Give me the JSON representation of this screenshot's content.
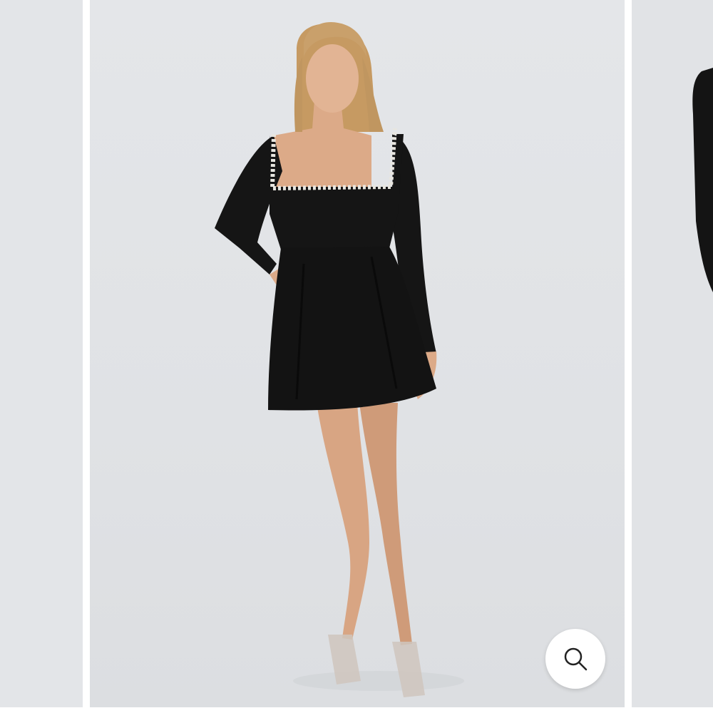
{
  "gallery": {
    "prev_image_label": "",
    "current_image_label": "",
    "next_image_label": ""
  },
  "zoom": {
    "icon": "search-icon"
  },
  "colors": {
    "background": "#e1e3e6",
    "dress": "#151515",
    "pearl": "#e8e6e0",
    "skin": "#d9a98a",
    "hair": "#c9a06b"
  }
}
